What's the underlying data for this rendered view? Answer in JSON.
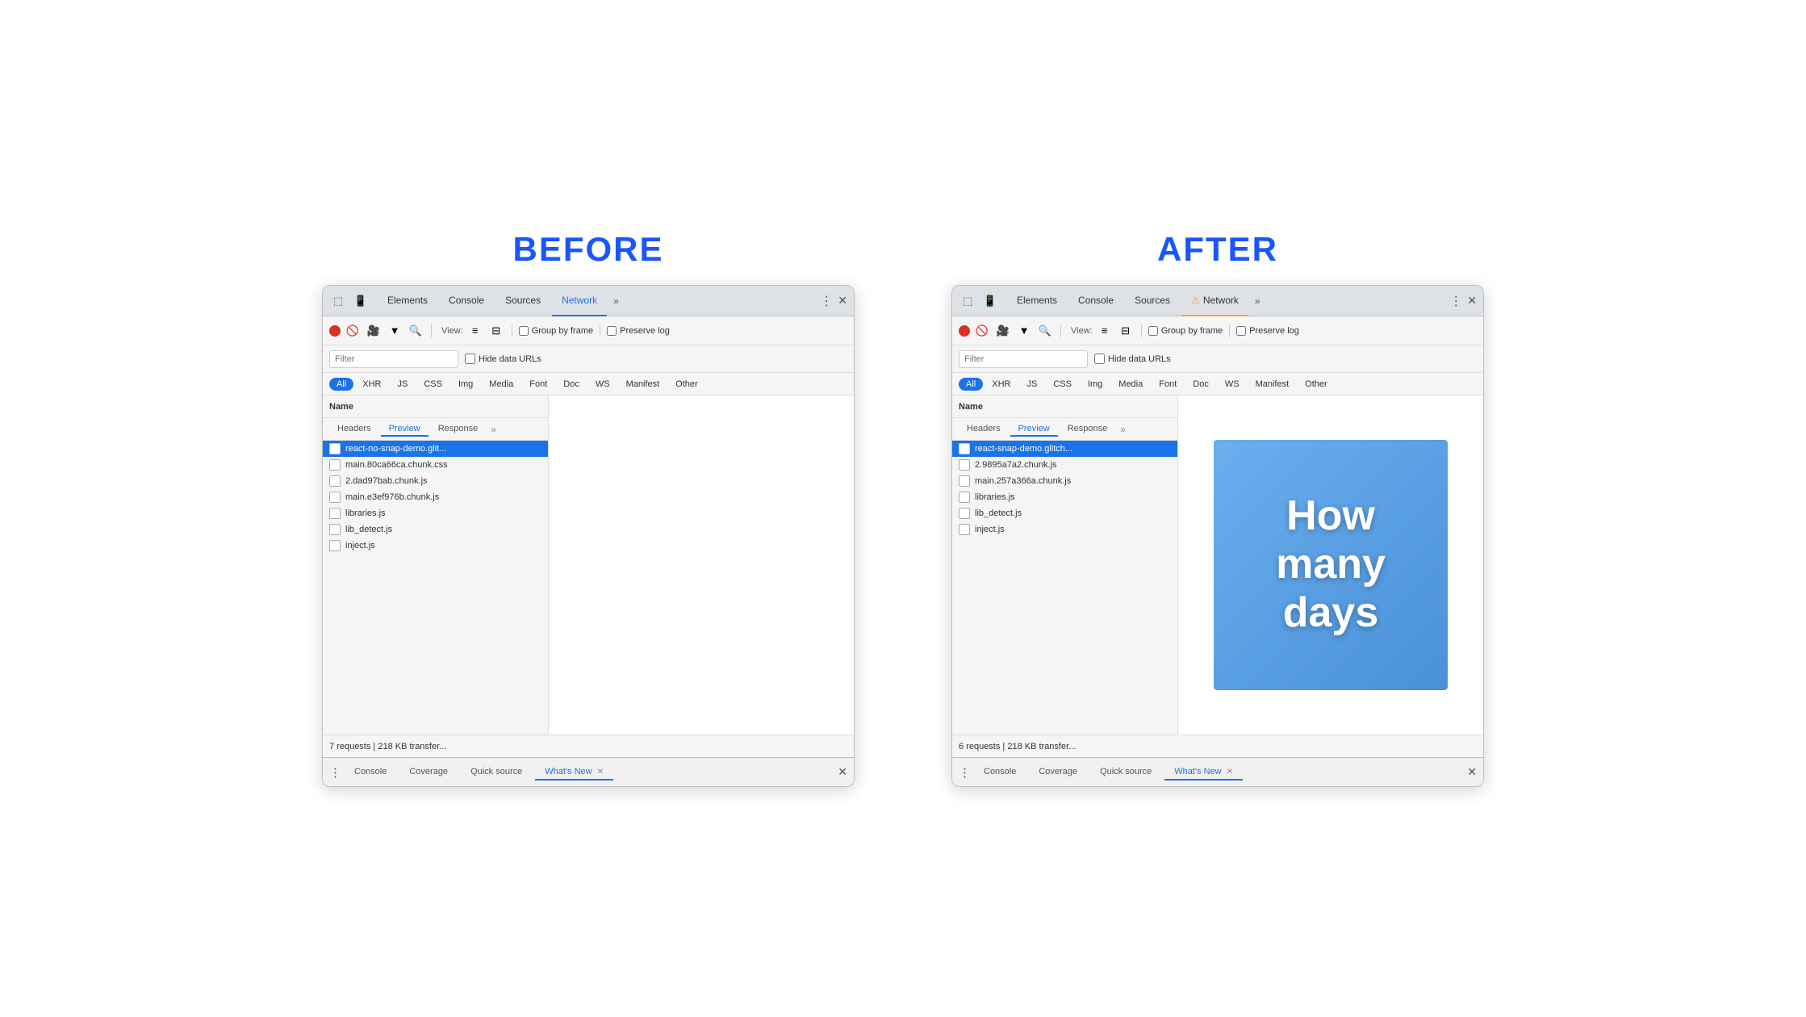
{
  "labels": {
    "before": "BEFORE",
    "after": "AFTER"
  },
  "before": {
    "tabs": [
      "Elements",
      "Console",
      "Sources",
      "Network"
    ],
    "active_tab": "Network",
    "toolbar": {
      "view_label": "View:",
      "group_by_frame": "Group by frame",
      "preserve_log": "Preserve log"
    },
    "filter_placeholder": "Filter",
    "hide_data_urls": "Hide data URLs",
    "resource_types": [
      "All",
      "XHR",
      "JS",
      "CSS",
      "Img",
      "Media",
      "Font",
      "Doc",
      "WS",
      "Manifest",
      "Other"
    ],
    "active_resource_type": "All",
    "file_list_header": "Name",
    "detail_tabs": [
      "Headers",
      "Preview",
      "Response"
    ],
    "active_detail_tab": "Preview",
    "files": [
      {
        "name": "react-no-snap-demo.glit...",
        "selected": true
      },
      {
        "name": "main.80ca66ca.chunk.css"
      },
      {
        "name": "2.dad97bab.chunk.js"
      },
      {
        "name": "main.e3ef976b.chunk.js"
      },
      {
        "name": "libraries.js"
      },
      {
        "name": "lib_detect.js"
      },
      {
        "name": "inject.js"
      }
    ],
    "status": "7 requests | 218 KB transfer...",
    "drawer_tabs": [
      "Console",
      "Coverage",
      "Quick source",
      "What's New"
    ],
    "active_drawer_tab": "What's New"
  },
  "after": {
    "tabs": [
      "Elements",
      "Console",
      "Sources",
      "Network"
    ],
    "active_tab": "Network",
    "active_tab_has_warning": true,
    "toolbar": {
      "view_label": "View:",
      "group_by_frame": "Group by frame",
      "preserve_log": "Preserve log"
    },
    "filter_placeholder": "Filter",
    "hide_data_urls": "Hide data URLs",
    "resource_types": [
      "All",
      "XHR",
      "JS",
      "CSS",
      "Img",
      "Media",
      "Font",
      "Doc",
      "WS",
      "Manifest",
      "Other"
    ],
    "active_resource_type": "All",
    "file_list_header": "Name",
    "detail_tabs": [
      "Headers",
      "Preview",
      "Response"
    ],
    "active_detail_tab": "Preview",
    "files": [
      {
        "name": "react-snap-demo.glitch...",
        "selected": true
      },
      {
        "name": "2.9895a7a2.chunk.js"
      },
      {
        "name": "main.257a366a.chunk.js"
      },
      {
        "name": "libraries.js"
      },
      {
        "name": "lib_detect.js"
      },
      {
        "name": "inject.js"
      }
    ],
    "preview_text": [
      "How",
      "many",
      "days"
    ],
    "status": "6 requests | 218 KB transfer...",
    "drawer_tabs": [
      "Console",
      "Coverage",
      "Quick source",
      "What's New"
    ],
    "active_drawer_tab": "What's New"
  }
}
